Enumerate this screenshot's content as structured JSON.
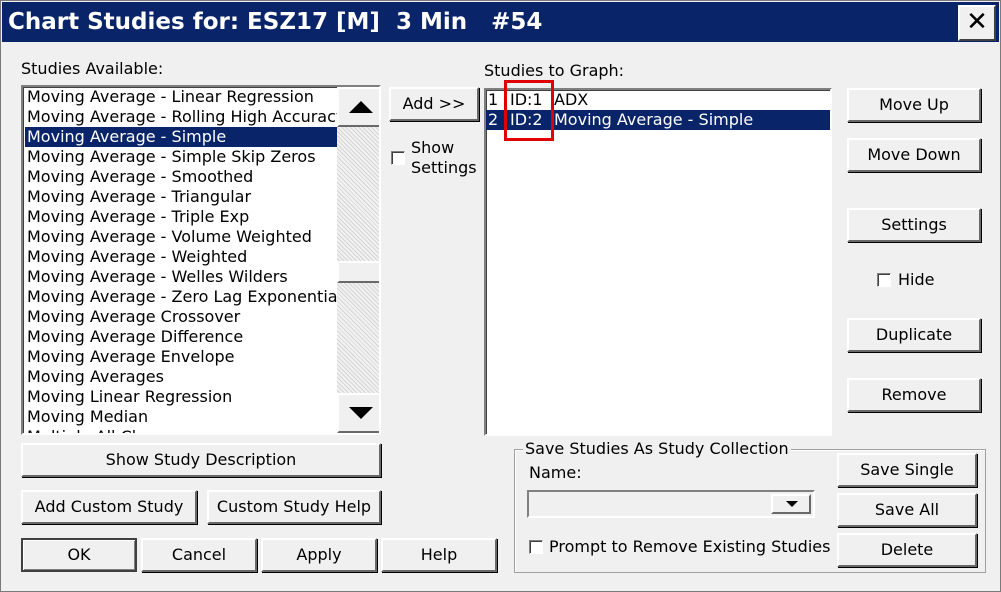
{
  "window": {
    "title": "Chart Studies for: ESZ17 [M]  3 Min   #54",
    "close_glyph": "✕"
  },
  "available": {
    "label": "Studies Available:",
    "items": [
      {
        "text": "Moving Average - Linear Regression",
        "selected": false
      },
      {
        "text": "Moving Average - Rolling High Accuracy",
        "selected": false
      },
      {
        "text": "Moving Average - Simple",
        "selected": true
      },
      {
        "text": "Moving Average - Simple Skip Zeros",
        "selected": false
      },
      {
        "text": "Moving Average - Smoothed",
        "selected": false
      },
      {
        "text": "Moving Average - Triangular",
        "selected": false
      },
      {
        "text": "Moving Average - Triple Exp",
        "selected": false
      },
      {
        "text": "Moving Average - Volume Weighted",
        "selected": false
      },
      {
        "text": "Moving Average - Weighted",
        "selected": false
      },
      {
        "text": "Moving Average - Welles Wilders",
        "selected": false
      },
      {
        "text": "Moving Average - Zero Lag Exponential",
        "selected": false
      },
      {
        "text": "Moving Average Crossover",
        "selected": false
      },
      {
        "text": "Moving Average Difference",
        "selected": false
      },
      {
        "text": "Moving Average Envelope",
        "selected": false
      },
      {
        "text": "Moving Averages",
        "selected": false
      },
      {
        "text": "Moving Linear Regression",
        "selected": false
      },
      {
        "text": "Moving Median",
        "selected": false
      },
      {
        "text": "Multiple All Ch...",
        "selected": false
      }
    ],
    "scroll_position": 0.55
  },
  "add_button": "Add >>",
  "show_settings": {
    "label_line1": "Show",
    "label_line2": "Settings",
    "checked": false
  },
  "graph": {
    "label": "Studies to Graph:",
    "rows": [
      {
        "num": "1",
        "id": "ID:1",
        "name": "ADX",
        "selected": false
      },
      {
        "num": "2",
        "id": "ID:2",
        "name": "Moving Average - Simple",
        "selected": true
      }
    ]
  },
  "right_buttons": {
    "move_up": "Move Up",
    "move_down": "Move Down",
    "settings": "Settings",
    "hide_label": "Hide",
    "hide_checked": false,
    "duplicate": "Duplicate",
    "remove": "Remove"
  },
  "bottom_left": {
    "show_description": "Show Study Description",
    "add_custom": "Add Custom Study",
    "custom_help": "Custom Study Help",
    "ok": "OK",
    "cancel": "Cancel",
    "apply": "Apply",
    "help": "Help"
  },
  "collection": {
    "title": "Save Studies As Study Collection",
    "name_label": "Name:",
    "name_value": "",
    "prompt_label": "Prompt to Remove Existing Studies",
    "prompt_checked": false,
    "save_single": "Save Single",
    "save_all": "Save All",
    "delete": "Delete"
  },
  "colors": {
    "selection": "#0a246a",
    "highlight_box": "#e00000",
    "dialog_bg": "#f0f0f0"
  }
}
